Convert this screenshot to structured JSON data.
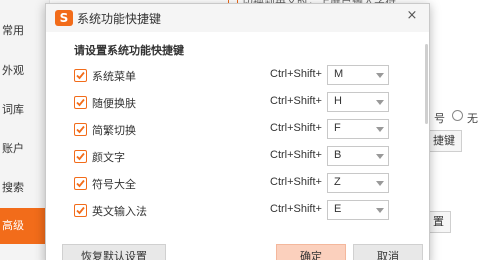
{
  "background": {
    "sidebar": {
      "items": [
        {
          "label": "常用"
        },
        {
          "label": "外观"
        },
        {
          "label": "词库"
        },
        {
          "label": "账户"
        },
        {
          "label": "搜索"
        },
        {
          "label": "高级"
        }
      ]
    },
    "top_text": "切换到英文时，上屏已输入字符",
    "radio_prefix": "号",
    "radio_label": "无",
    "button_shortcut": "捷键",
    "button_reset": "置"
  },
  "dialog": {
    "title": "系统功能快捷键",
    "close_symbol": "×",
    "prompt": "请设置系统功能快捷键",
    "rows": [
      {
        "name": "系统菜单",
        "modifier": "Ctrl+Shift+",
        "key": "M",
        "checked": true
      },
      {
        "name": "随便换肤",
        "modifier": "Ctrl+Shift+",
        "key": "H",
        "checked": true
      },
      {
        "name": "简繁切换",
        "modifier": "Ctrl+Shift+",
        "key": "F",
        "checked": true
      },
      {
        "name": "颜文字",
        "modifier": "Ctrl+Shift+",
        "key": "B",
        "checked": true
      },
      {
        "name": "符号大全",
        "modifier": "Ctrl+Shift+",
        "key": "Z",
        "checked": true
      },
      {
        "name": "英文输入法",
        "modifier": "Ctrl+Shift+",
        "key": "E",
        "checked": true
      }
    ],
    "buttons": {
      "reset": "恢复默认设置",
      "ok": "确定",
      "cancel": "取消"
    }
  },
  "colors": {
    "accent": "#f26c1a",
    "ok_button": "#fbd0bd"
  },
  "icons": {
    "logo": "sogou-s-logo",
    "check": "checkmark-icon",
    "close": "close-icon",
    "dropdown": "chevron-down-icon"
  }
}
